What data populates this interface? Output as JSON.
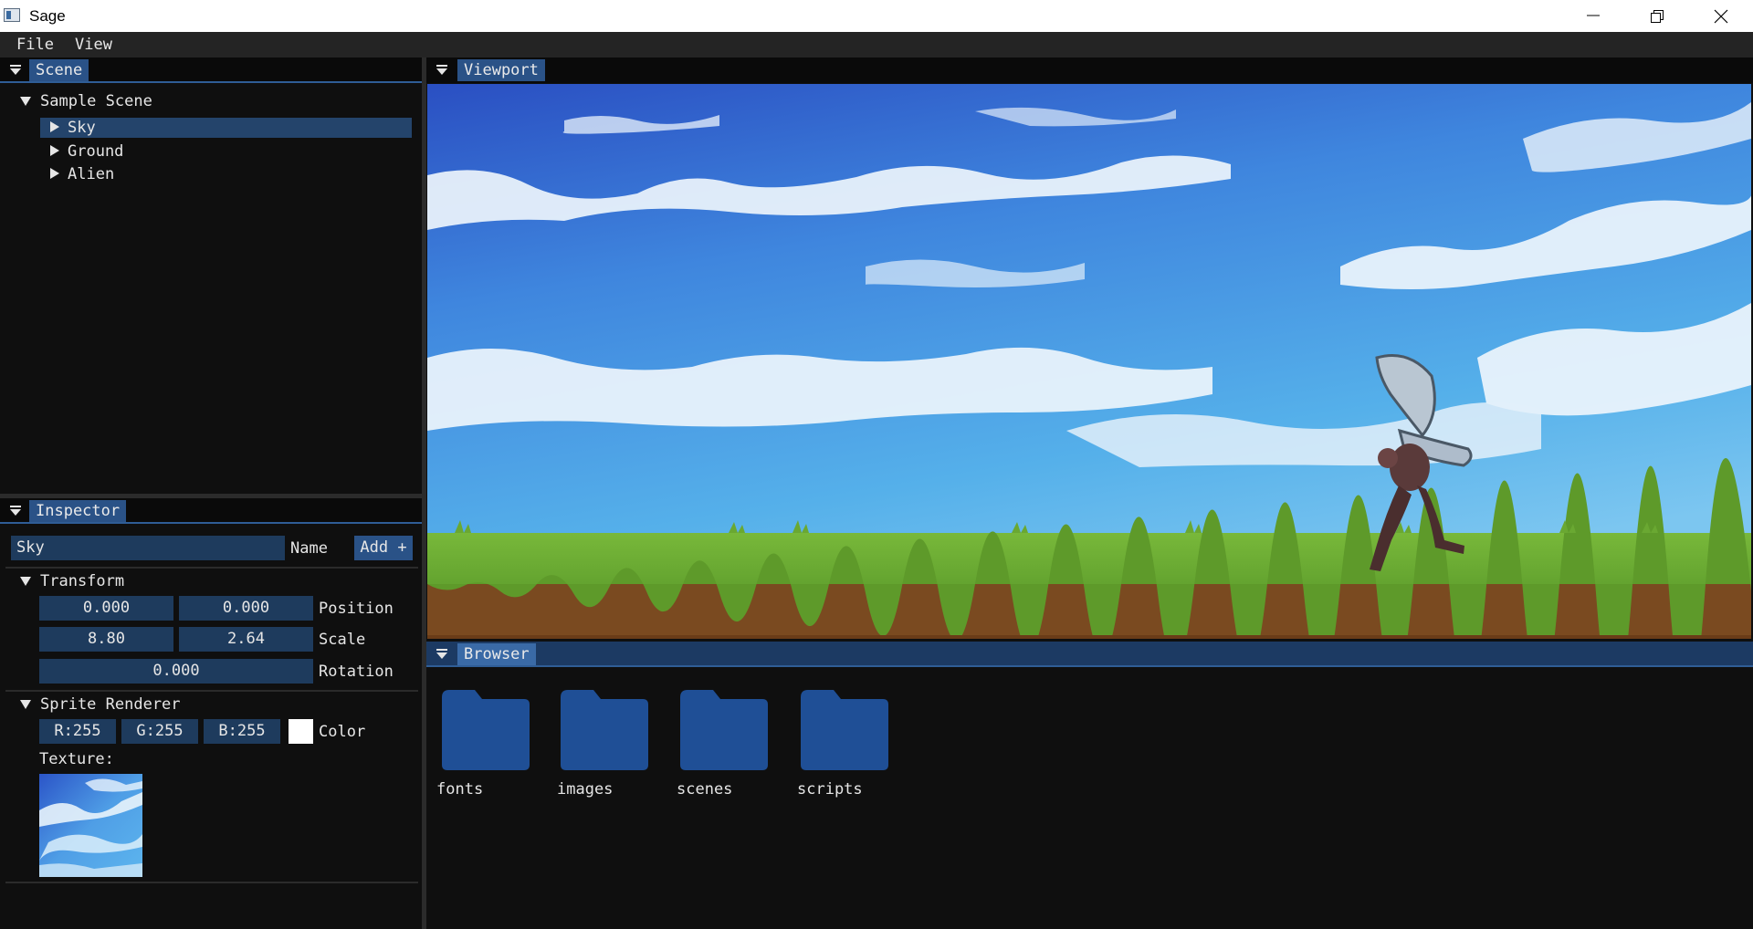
{
  "window": {
    "title": "Sage",
    "controls": [
      "minimize-icon",
      "restore-icon",
      "close-icon"
    ]
  },
  "menubar": {
    "items": [
      {
        "label": "File"
      },
      {
        "label": "View"
      }
    ]
  },
  "scene_panel": {
    "tab": "Scene",
    "tree": {
      "root": "Sample Scene",
      "children": [
        {
          "label": "Sky",
          "selected": true
        },
        {
          "label": "Ground",
          "selected": false
        },
        {
          "label": "Alien",
          "selected": false
        }
      ]
    }
  },
  "inspector": {
    "tab": "Inspector",
    "name_value": "Sky",
    "name_label": "Name",
    "add_label": "Add +",
    "transform": {
      "header": "Transform",
      "position": [
        "0.000",
        "0.000"
      ],
      "position_label": "Position",
      "scale": [
        "8.80",
        "2.64"
      ],
      "scale_label": "Scale",
      "rotation": "0.000",
      "rotation_label": "Rotation"
    },
    "sprite_renderer": {
      "header": "Sprite Renderer",
      "r": "R:255",
      "g": "G:255",
      "b": "B:255",
      "color_label": "Color",
      "swatch_color": "#ffffff",
      "texture_label": "Texture:"
    }
  },
  "viewport": {
    "tab": "Viewport"
  },
  "browser": {
    "tab": "Browser",
    "folders": [
      {
        "label": "fonts"
      },
      {
        "label": "images"
      },
      {
        "label": "scenes"
      },
      {
        "label": "scripts"
      }
    ],
    "folder_color": "#1f4f96"
  },
  "colors": {
    "accent": "#2a5287",
    "field_bg": "#1e3b5d",
    "panel_bg": "#0f0f0f"
  }
}
